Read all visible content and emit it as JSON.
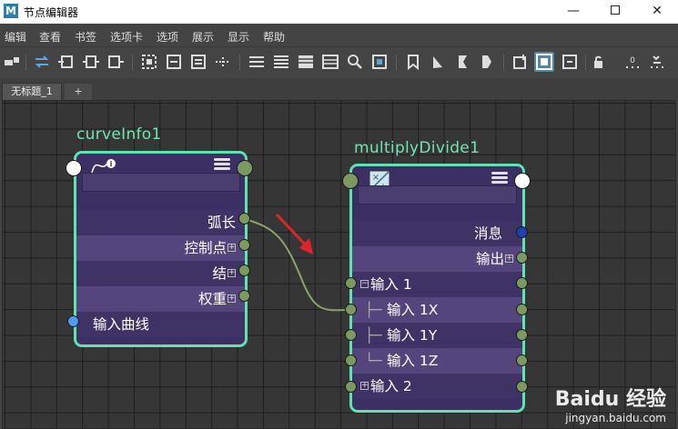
{
  "window": {
    "logo": "M",
    "title": "节点编辑器",
    "minimize": "—",
    "close": "✕"
  },
  "menu": [
    "编辑",
    "查看",
    "书签",
    "选项卡",
    "选项",
    "展示",
    "显示",
    "帮助"
  ],
  "tabs": {
    "active": "无标题_1",
    "add": "+"
  },
  "nodes": {
    "curve": {
      "title": "curveInfo1",
      "attrs": [
        "弧长",
        "控制点",
        "结",
        "权重"
      ],
      "input": "输入曲线"
    },
    "mult": {
      "title": "multiplyDivide1",
      "message": "消息",
      "output": "输出",
      "input1": "输入 1",
      "input1_children": [
        "输入 1X",
        "输入 1Y",
        "输入 1Z"
      ],
      "input2": "输入 2",
      "icon_symbols": "×÷"
    }
  },
  "colors": {
    "node_border": "#5ee3b1",
    "node_title": "#6fe6b0",
    "connection": "#8aa46a",
    "arrow": "#e0232a",
    "toolbar_active": "#5285a6"
  },
  "watermark": {
    "main": "Baidu 经验",
    "url": "jingyan.baidu.com"
  }
}
